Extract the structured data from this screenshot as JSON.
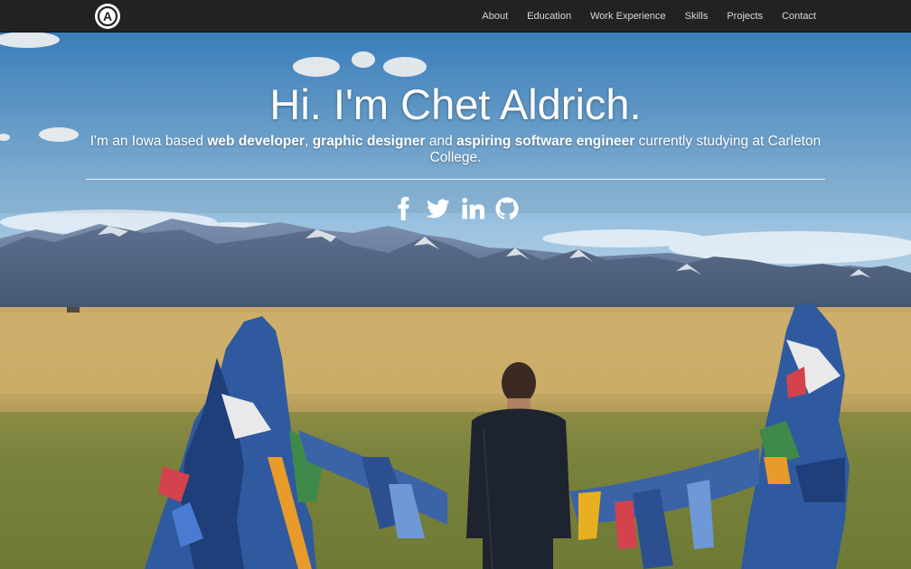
{
  "nav": {
    "logo_letter": "A",
    "items": [
      {
        "label": "About"
      },
      {
        "label": "Education"
      },
      {
        "label": "Work Experience"
      },
      {
        "label": "Skills"
      },
      {
        "label": "Projects"
      },
      {
        "label": "Contact"
      }
    ]
  },
  "hero": {
    "title": "Hi. I'm Chet Aldrich.",
    "subtitle_parts": {
      "p1": "I'm an Iowa based ",
      "b1": "web developer",
      "p2": ", ",
      "b2": "graphic designer",
      "p3": " and ",
      "b3": "aspiring software engineer",
      "p4": " currently studying at Carleton College."
    },
    "socials": [
      {
        "icon": "facebook-icon"
      },
      {
        "icon": "twitter-icon"
      },
      {
        "icon": "linkedin-icon"
      },
      {
        "icon": "github-icon"
      }
    ]
  },
  "colors": {
    "navbar": "#222222",
    "nav_text": "#d9d9d9",
    "hero_text": "#ffffff"
  }
}
